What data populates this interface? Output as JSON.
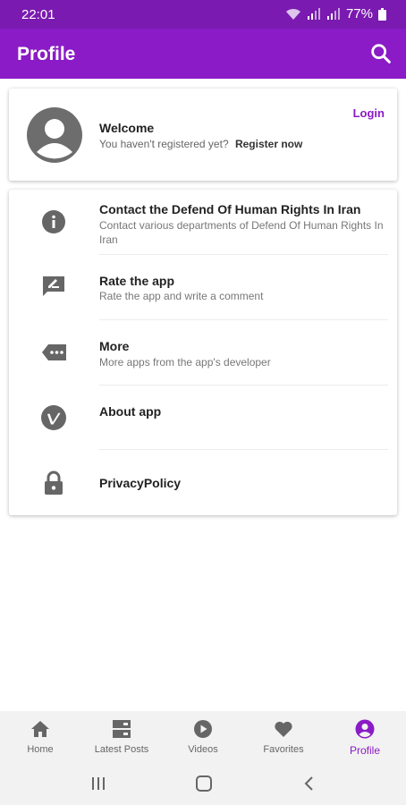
{
  "status_bar": {
    "time": "22:01",
    "battery": "77%"
  },
  "app_bar": {
    "title": "Profile",
    "search_icon": "search-icon"
  },
  "welcome": {
    "title": "Welcome",
    "subtitle": "You haven't registered yet?",
    "register_label": "Register now",
    "login_label": "Login"
  },
  "menu": {
    "items": [
      {
        "icon": "info-icon",
        "title": "Contact the Defend Of Human Rights In Iran",
        "subtitle": "Contact various departments of Defend Of Human Rights In Iran"
      },
      {
        "icon": "rate-comment-icon",
        "title": "Rate the app",
        "subtitle": "Rate the app and write a comment"
      },
      {
        "icon": "more-label-icon",
        "title": "More",
        "subtitle": "More apps from the app's developer"
      },
      {
        "icon": "vimeo-icon",
        "title": "About app",
        "subtitle": ""
      },
      {
        "icon": "lock-icon",
        "title": "PrivacyPolicy",
        "subtitle": ""
      }
    ]
  },
  "bottom_nav": {
    "items": [
      {
        "label": "Home",
        "icon": "home-icon"
      },
      {
        "label": "Latest Posts",
        "icon": "list-icon"
      },
      {
        "label": "Videos",
        "icon": "play-icon"
      },
      {
        "label": "Favorites",
        "icon": "heart-icon"
      },
      {
        "label": "Profile",
        "icon": "account-icon"
      }
    ],
    "active": "Profile"
  },
  "colors": {
    "primary": "#8a1bc6",
    "status_bar": "#7a1ab0",
    "icon_gray": "#666666"
  }
}
